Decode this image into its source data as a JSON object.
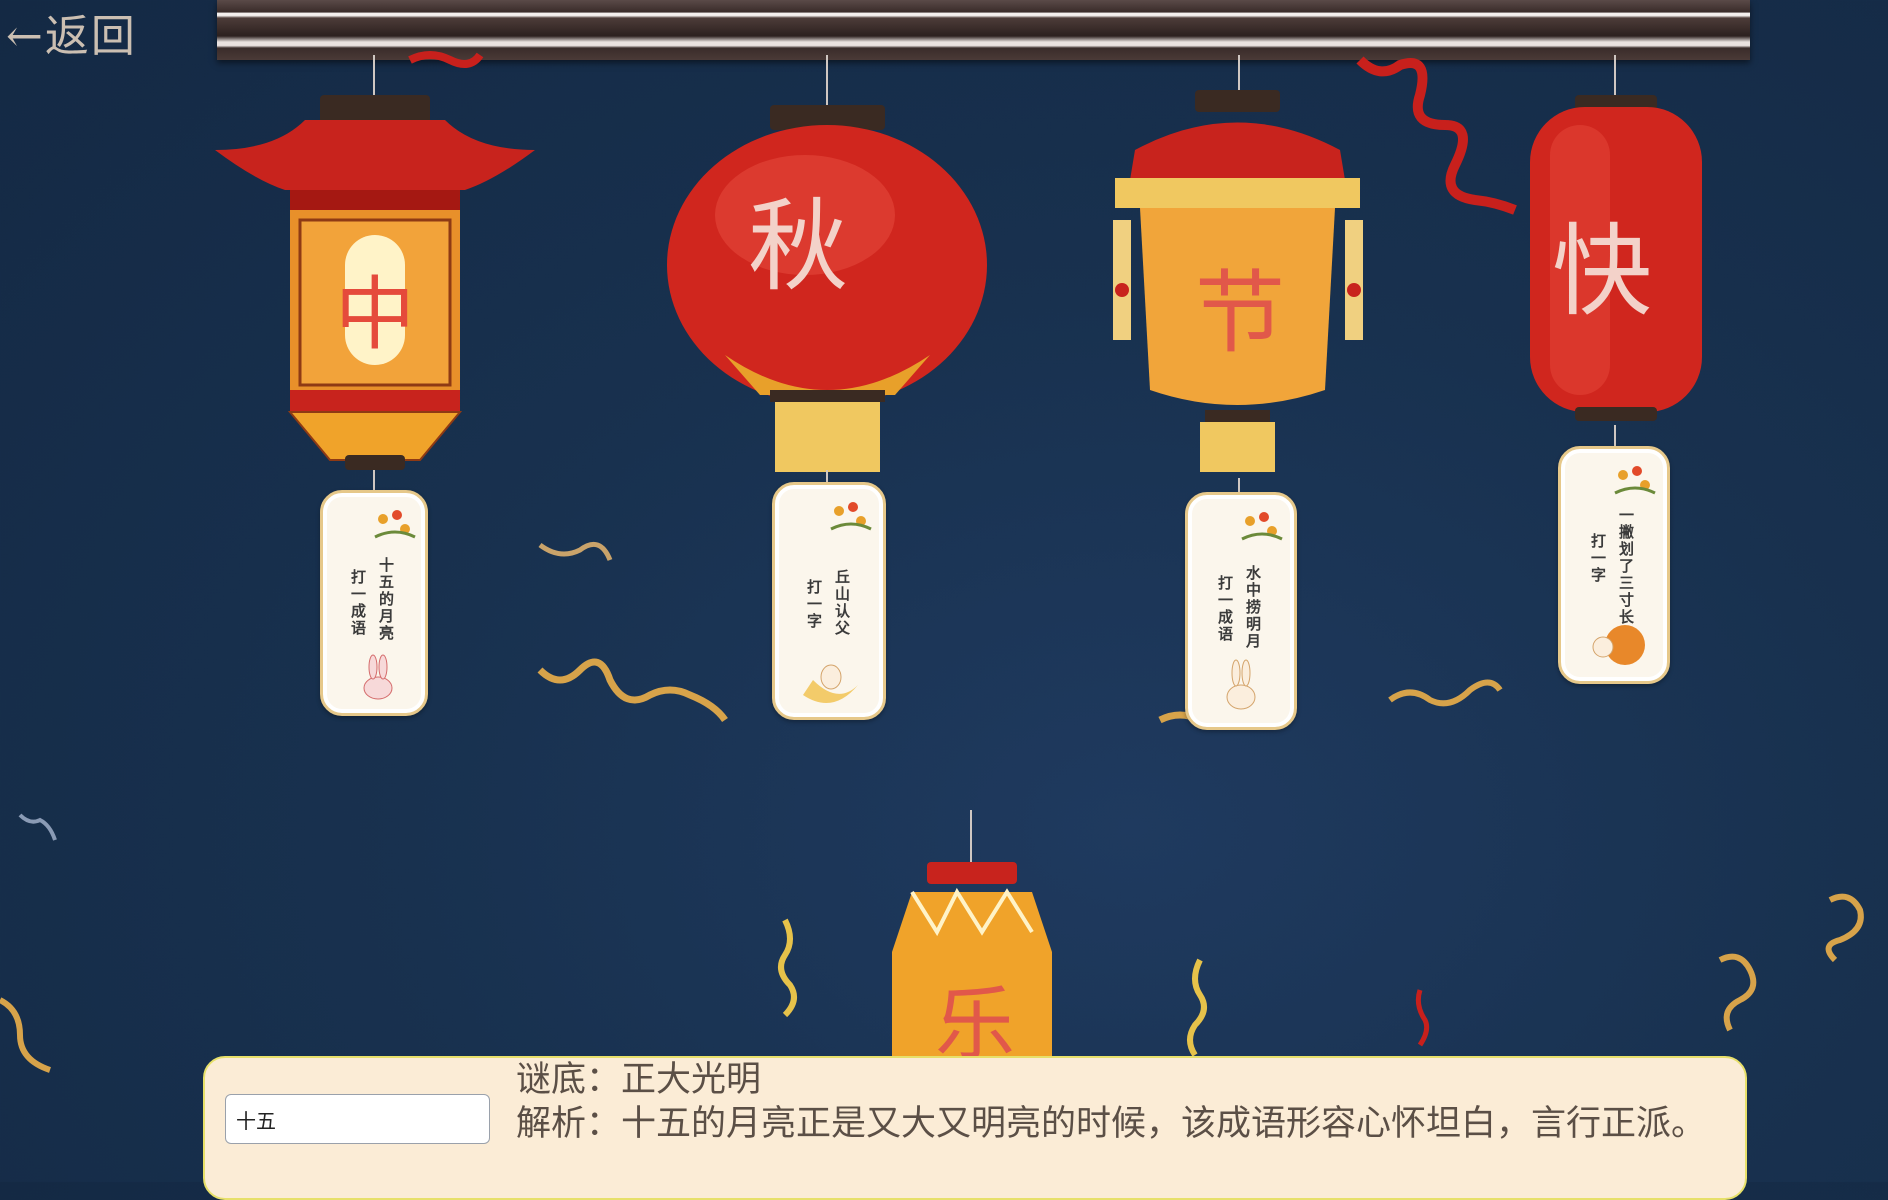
{
  "nav": {
    "back_label": "←返回"
  },
  "lanterns": [
    {
      "char": "中",
      "riddle_lines": [
        "十五的月亮",
        "打一成语"
      ]
    },
    {
      "char": "秋",
      "riddle_lines": [
        "丘山认父",
        "打一字"
      ]
    },
    {
      "char": "节",
      "riddle_lines": [
        "水中捞明月",
        "打一成语"
      ]
    },
    {
      "char": "快",
      "riddle_lines": [
        "一撇划了三寸长",
        "打一字"
      ]
    },
    {
      "char": "乐"
    }
  ],
  "answer_panel": {
    "input_value": "十五",
    "answer_label": "谜底：正大光明",
    "explanation": "解析：十五的月亮正是又大又明亮的时候，该成语形容心怀坦白，言行正派。"
  },
  "colors": {
    "background": "#18314f",
    "lantern_red": "#d2231e",
    "lantern_gold": "#f0a32a",
    "panel_bg": "#fbecd6",
    "panel_border": "#e7e06a"
  }
}
